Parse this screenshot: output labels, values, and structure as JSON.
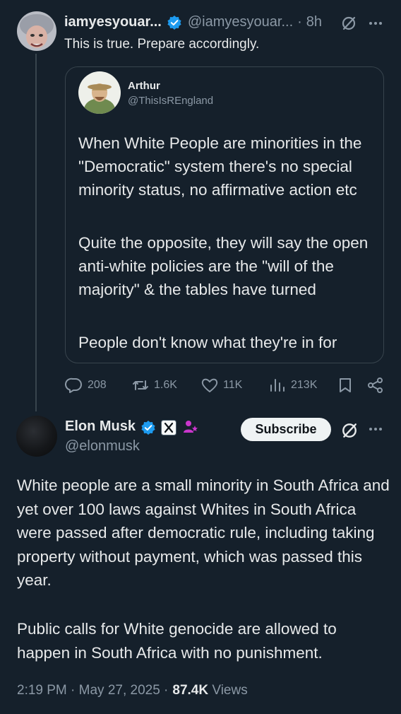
{
  "reply": {
    "display_name": "iamyesyouar...",
    "handle": "@iamyesyouar...",
    "separator": "·",
    "time": "8h",
    "text": "This is true. Prepare accordingly.",
    "stats": {
      "replies": "208",
      "reposts": "1.6K",
      "likes": "11K",
      "views": "213K"
    }
  },
  "quote": {
    "display_name": "Arthur",
    "handle": "@ThisIsREngland",
    "paragraphs": [
      "When White People are minorities in the \"Democratic\" system there's no special minority status, no affirmative action etc",
      "Quite the opposite, they will say the open anti-white policies are the \"will of the majority\" & the tables have turned",
      "People don't know what they're in for"
    ]
  },
  "main": {
    "display_name": "Elon Musk",
    "handle": "@elonmusk",
    "subscribe_label": "Subscribe",
    "paragraphs": [
      "White people are a small minority in South Africa and yet over 100 laws against Whites in South Africa were passed after democratic rule, including taking property without payment, which was passed this year.",
      "Public calls for White genocide are allowed to happen in South Africa with no punishment."
    ],
    "timestamp": "2:19 PM · May 27, 2025 · ",
    "views_count": "87.4K",
    "views_label": " Views"
  },
  "colors": {
    "background": "#15202b",
    "text": "#e7e9ea",
    "muted": "#8b98a5",
    "border": "#38444d",
    "verified": "#1d9bf0"
  },
  "icons": [
    "verified-badge-icon",
    "grok-icon",
    "more-icon",
    "reply-icon",
    "repost-icon",
    "like-icon",
    "views-icon",
    "bookmark-icon",
    "share-icon",
    "x-affiliate-icon",
    "affiliate-person-icon"
  ]
}
